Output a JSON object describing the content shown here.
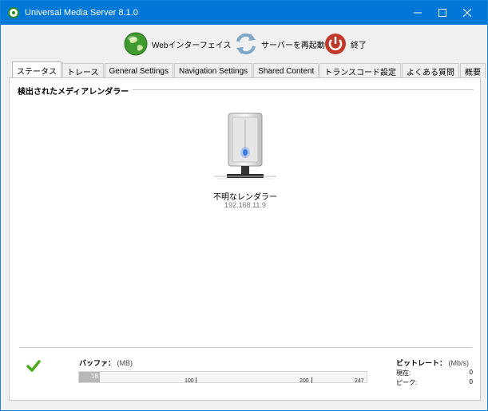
{
  "window": {
    "title": "Universal Media Server 8.1.0",
    "controls": [
      "minimize",
      "maximize",
      "close"
    ]
  },
  "toolbar": {
    "web_label": "Webインターフェイス",
    "restart_label": "サーバーを再起動",
    "quit_label": "終了"
  },
  "tabs": [
    {
      "label": "ステータス",
      "active": true
    },
    {
      "label": "トレース",
      "active": false
    },
    {
      "label": "General Settings",
      "active": false
    },
    {
      "label": "Navigation Settings",
      "active": false
    },
    {
      "label": "Shared Content",
      "active": false
    },
    {
      "label": "トランスコード設定",
      "active": false
    },
    {
      "label": "よくある質問",
      "active": false
    },
    {
      "label": "概要",
      "active": false
    }
  ],
  "status": {
    "section_title": "検出されたメディアレンダラー",
    "renderer": {
      "name": "不明なレンダラー",
      "ip": "192.168.11.9"
    }
  },
  "buffer": {
    "label": "バッファ：",
    "unit": "(MB)",
    "value": "18",
    "max": 247,
    "ticks": [
      "100",
      "200",
      "247"
    ]
  },
  "bitrate": {
    "label": "ビットレート：",
    "unit": "(Mb/s)",
    "current_label": "現在:",
    "current_value": "0",
    "peak_label": "ピーク:",
    "peak_value": "0"
  },
  "colors": {
    "titlebar": "#0078d7",
    "check": "#4caa1f"
  }
}
